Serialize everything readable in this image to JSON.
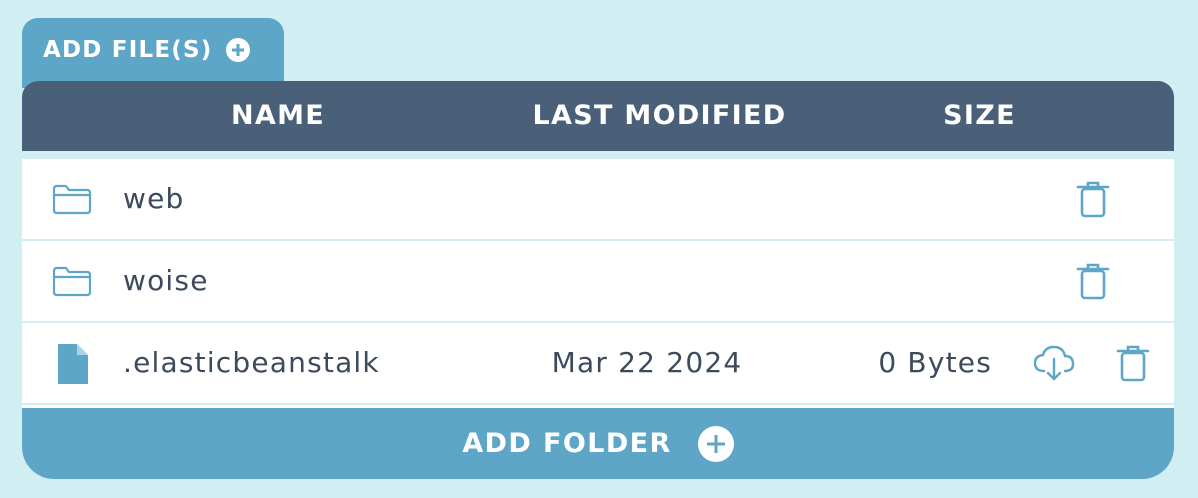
{
  "toolbar": {
    "add_files_label": "ADD FILE(S)",
    "add_folder_label": "ADD FOLDER"
  },
  "table": {
    "headers": {
      "name": "NAME",
      "last_modified": "LAST MODIFIED",
      "size": "SIZE"
    },
    "rows": [
      {
        "type": "folder",
        "name": "web",
        "last_modified": "",
        "size": ""
      },
      {
        "type": "folder",
        "name": "woise",
        "last_modified": "",
        "size": ""
      },
      {
        "type": "file",
        "name": ".elasticbeanstalk",
        "last_modified": "Mar 22 2024",
        "size": "0 Bytes"
      }
    ]
  },
  "icons": {
    "add_files": "plus-circle-icon",
    "add_folder": "plus-circle-icon",
    "folder": "folder-icon",
    "file": "file-icon",
    "delete": "trash-icon",
    "download": "cloud-download-icon"
  },
  "colors": {
    "background": "#d1eef2",
    "accent": "#5ea6c7",
    "header": "#4a6078",
    "text": "#3d4a5c"
  }
}
